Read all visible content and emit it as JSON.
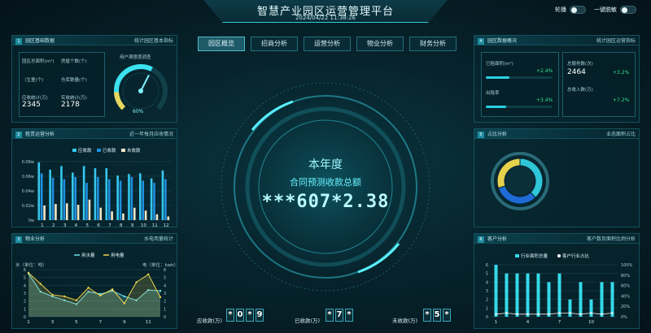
{
  "header": {
    "title": "智慧产业园区运营管理平台",
    "datetime": "2024/04/22 11:38:26",
    "carousel_label": "轮播",
    "desensitize_label": "一键脱敏"
  },
  "tabs": [
    {
      "label": "园区概览",
      "active": true
    },
    {
      "label": "招商分析",
      "active": false
    },
    {
      "label": "运营分析",
      "active": false
    },
    {
      "label": "物业分析",
      "active": false
    },
    {
      "label": "财务分析",
      "active": false
    }
  ],
  "panel1": {
    "num": "1",
    "title": "园区基础数据",
    "subtitle": "统计园区基本指标",
    "stats": [
      {
        "label": "园区总面积(m²)",
        "value": ""
      },
      {
        "label": "房屋个数(个)",
        "value": ""
      },
      {
        "label": "（生童(个)",
        "value": ""
      },
      {
        "label": "仓库数量(个)",
        "value": ""
      },
      {
        "label": "应收统计(万)",
        "value": "2345"
      },
      {
        "label": "实收统计(万)",
        "value": "2178"
      }
    ],
    "gauge": {
      "title": "用户满意度调查",
      "value": "60%",
      "level": 0.6
    }
  },
  "panel2": {
    "num": "2",
    "title": "租赁运营分析",
    "subtitle": "近一年每月应收情况",
    "legend": [
      "应收款",
      "已收款",
      "未收款"
    ],
    "colors": [
      "#35c8ef",
      "#1e8fe0",
      "#f3e7c8"
    ]
  },
  "panel3": {
    "num": "3",
    "title": "物业分析",
    "subtitle": "水电用量统计",
    "left_unit": "水（单位：吨）",
    "right_unit": "电（单位：kwh）",
    "legend": [
      "用水量",
      "用电量"
    ],
    "colors": [
      "#6fe2ee",
      "#f0d34c"
    ]
  },
  "panel4": {
    "num": "4",
    "title": "园区数据概况",
    "subtitle": "统计园区运营指标",
    "items": [
      {
        "label": "已租面积(m²)",
        "value": "",
        "pct": "+2.4%",
        "fill": 0.35
      },
      {
        "label": "出租率",
        "value": "",
        "pct": "+3.4%",
        "fill": 0.3
      },
      {
        "label": "总服务数(次)",
        "value": "2464",
        "pct": "+3.2%"
      },
      {
        "label": "总收入数(万)",
        "value": "",
        "pct": "+7.2%"
      }
    ]
  },
  "panel5": {
    "num": "5",
    "title": "占比分析",
    "subtitle": "业态面积占比"
  },
  "panel6": {
    "num": "6",
    "title": "客户分析",
    "subtitle": "客户数及面积比例分析",
    "legend": [
      "行业面积总量",
      "客户行业占比"
    ]
  },
  "center": {
    "line1": "本年度",
    "line2": "合同预测收款总额",
    "amount": "***607*2.38"
  },
  "counters": [
    {
      "label": "应收款(万)",
      "digits": [
        "*",
        "0",
        "*",
        "9"
      ]
    },
    {
      "label": "已收款(万)",
      "digits": [
        "*",
        "7",
        "*"
      ]
    },
    {
      "label": "未收款(万)",
      "digits": [
        "*",
        "5",
        "*"
      ]
    }
  ],
  "chart_data": [
    {
      "type": "bar",
      "title": "近一年每月应收情况",
      "categories": [
        "1",
        "2",
        "3",
        "4",
        "5",
        "6",
        "7",
        "8",
        "9",
        "10",
        "11",
        "12"
      ],
      "series": [
        {
          "name": "应收款",
          "values": [
            0.079,
            0.069,
            0.074,
            0.065,
            0.074,
            0.071,
            0.071,
            0.061,
            0.063,
            0.064,
            0.057,
            0.068
          ]
        },
        {
          "name": "已收款",
          "values": [
            0.064,
            0.058,
            0.056,
            0.059,
            0.051,
            0.059,
            0.056,
            0.054,
            0.059,
            0.054,
            0.051,
            0.056
          ]
        },
        {
          "name": "未收款",
          "values": [
            0.02,
            0.022,
            0.023,
            0.021,
            0.028,
            0.017,
            0.012,
            0.009,
            0.017,
            0.013,
            0.008,
            0.005
          ]
        }
      ],
      "y_ticks": [
        "0w",
        "0.02w",
        "0.04w",
        "0.06w",
        "0.08w"
      ],
      "ylim": [
        0,
        0.08
      ]
    },
    {
      "type": "area",
      "title": "水电用量统计",
      "categories": [
        "1",
        "2",
        "3",
        "4",
        "5",
        "6",
        "7",
        "8",
        "9",
        "10",
        "11",
        "12"
      ],
      "x_ticks": [
        "1",
        "3",
        "5",
        "7",
        "9",
        "11"
      ],
      "series": [
        {
          "name": "用水量",
          "values": [
            5.5,
            3.2,
            2.6,
            2.1,
            1.6,
            3.2,
            2.9,
            3.3,
            2.6,
            2.1,
            3.4,
            3.3
          ]
        },
        {
          "name": "用电量",
          "values": [
            5.6,
            4.2,
            2.8,
            2.6,
            2.1,
            3.7,
            2.7,
            3.5,
            1.7,
            4.4,
            5.4,
            2.5
          ]
        }
      ],
      "y_ticks_left": [
        "0",
        "1",
        "2",
        "3",
        "4",
        "5",
        "6"
      ],
      "y_ticks_right": [
        "0",
        "1",
        "2",
        "3",
        "4",
        "5",
        "6"
      ],
      "ylim": [
        0,
        6
      ]
    },
    {
      "type": "pie",
      "title": "业态面积占比",
      "values": [
        38,
        32,
        30
      ],
      "colors": [
        "#2fc6d8",
        "#1f6bd6",
        "#e6d24b"
      ]
    },
    {
      "type": "bar",
      "title": "客户数及面积比例分析",
      "categories": [
        "1",
        "2",
        "3",
        "4",
        "5",
        "6",
        "7",
        "8",
        "9",
        "10",
        "11",
        "12"
      ],
      "x_ticks": [
        "1",
        "4",
        "7",
        "10"
      ],
      "series": [
        {
          "name": "行业面积总量",
          "values": [
            6,
            5,
            5,
            5,
            5,
            4,
            5,
            2,
            4,
            2,
            4,
            4
          ]
        },
        {
          "name": "客户行业占比",
          "values": [
            0.05,
            0.07,
            0.05,
            0.05,
            0.05,
            0.05,
            0.07,
            0.07,
            0.05,
            0.07,
            0.05,
            0.07
          ]
        }
      ],
      "y_ticks_left": [
        "0",
        "1",
        "2",
        "3",
        "4",
        "5",
        "6"
      ],
      "y_ticks_right": [
        "0%",
        "20%",
        "40%",
        "60%",
        "80%",
        "100%"
      ],
      "ylim": [
        0,
        6
      ]
    }
  ]
}
